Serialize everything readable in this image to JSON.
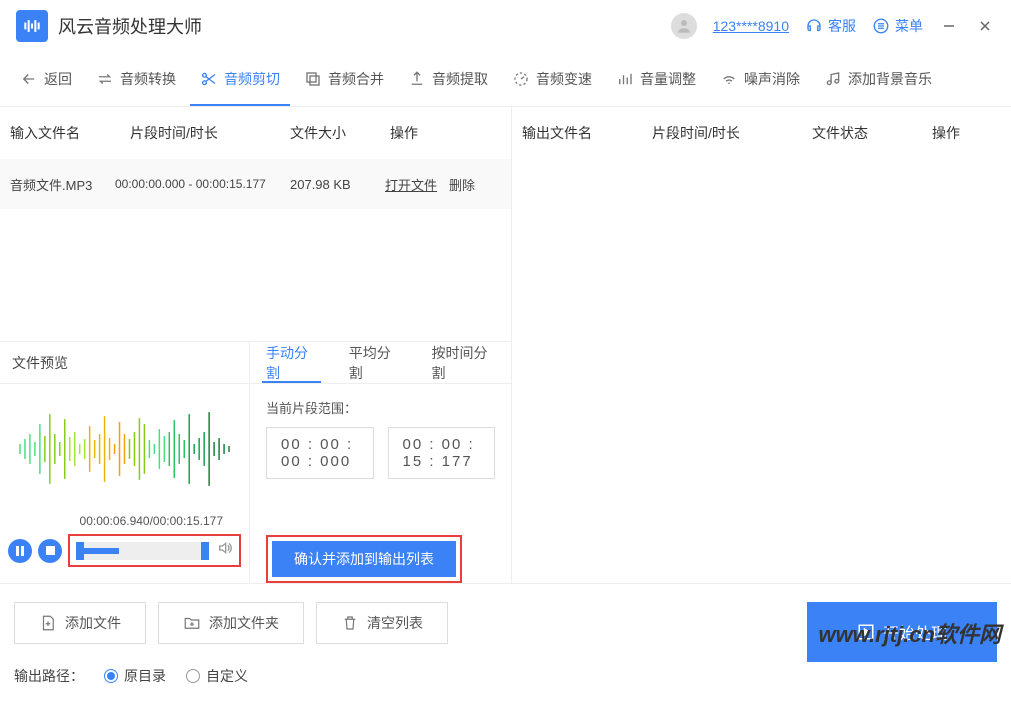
{
  "app_title": "风云音频处理大师",
  "user": {
    "name": "123****8910"
  },
  "header_links": {
    "service": "客服",
    "menu": "菜单"
  },
  "toolbar": {
    "back": "返回",
    "convert": "音频转换",
    "cut": "音频剪切",
    "merge": "音频合并",
    "extract": "音频提取",
    "speed": "音频变速",
    "volume": "音量调整",
    "denoise": "噪声消除",
    "bgm": "添加背景音乐"
  },
  "input_table": {
    "cols": {
      "name": "输入文件名",
      "time": "片段时间/时长",
      "size": "文件大小",
      "op": "操作"
    },
    "row": {
      "filename": "音频文件.MP3",
      "segment": "00:00:00.000 - 00:00:15.177",
      "size": "207.98 KB",
      "open": "打开文件",
      "delete": "删除"
    }
  },
  "output_table": {
    "cols": {
      "name": "输出文件名",
      "time": "片段时间/时长",
      "status": "文件状态",
      "op": "操作"
    }
  },
  "preview": {
    "title": "文件预览",
    "time": "00:00:06.940/00:00:15.177"
  },
  "split": {
    "tabs": {
      "manual": "手动分割",
      "avg": "平均分割",
      "bytime": "按时间分割"
    },
    "range_label": "当前片段范围：",
    "start": "00 : 00 : 00 : 000",
    "end": "00 : 00 : 15 : 177",
    "confirm": "确认并添加到输出列表"
  },
  "bottom": {
    "add_file": "添加文件",
    "add_folder": "添加文件夹",
    "clear": "清空列表",
    "start": "开始处理",
    "output_path_label": "输出路径：",
    "orig_dir": "原目录",
    "custom": "自定义"
  },
  "watermark": "www.rjtj.cn软件网"
}
